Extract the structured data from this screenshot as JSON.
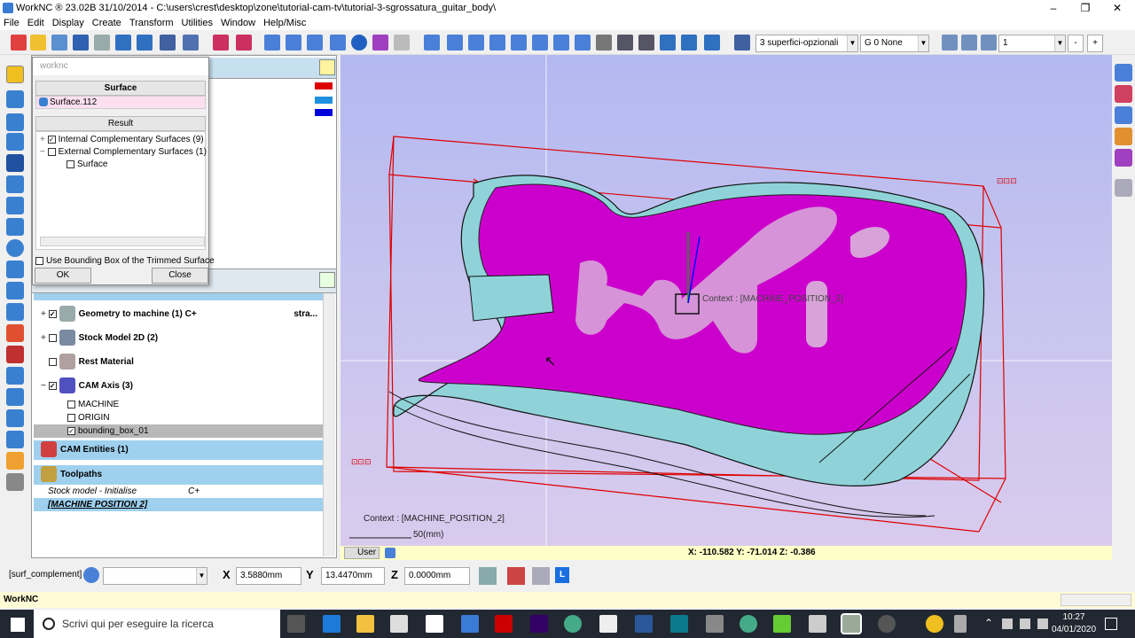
{
  "window": {
    "title": "WorkNC ® 23.02B   31/10/2014 - C:\\users\\crest\\desktop\\zone\\tutorial-cam-tv\\tutorial-3-sgrossatura_guitar_body\\",
    "min": "–",
    "max": "❐",
    "close": "✕"
  },
  "menu": [
    "File",
    "Edit",
    "Display",
    "Create",
    "Transform",
    "Utilities",
    "Window",
    "Help/Misc"
  ],
  "toolbar": {
    "layer_combo": "3   superfici-opzionali",
    "group_combo": "G   0 None",
    "num_combo": "1",
    "minus": "-",
    "plus": "+"
  },
  "dialog": {
    "title": "worknc",
    "surface_header": "Surface",
    "surface_value": "Surface.112",
    "result_header": "Result",
    "result_items": [
      "Internal Complementary Surfaces (9)",
      "External Complementary Surfaces (1)",
      "Surface"
    ],
    "bbox_label": "Use Bounding Box of the Trimmed Surface",
    "ok": "OK",
    "close": "Close"
  },
  "tree": {
    "items": [
      {
        "label": "Geometry to machine (1) C+",
        "extra": "stra..."
      },
      {
        "label": "Stock Model 2D (2)",
        "extra": ""
      },
      {
        "label": "Rest Material",
        "extra": ""
      },
      {
        "label": "CAM Axis (3)",
        "extra": ""
      }
    ],
    "axes": [
      "MACHINE",
      "ORIGIN",
      "bounding_box_01"
    ],
    "cam_entities": "CAM Entities (1)",
    "toolpaths": "Toolpaths",
    "stock_init": "Stock model - Initialise",
    "stock_init_flag": "C+",
    "machine_pos": "[MACHINE POSITION 2]"
  },
  "viewport": {
    "context_label": "Context : [MACHINE_POSITION_2]",
    "context_center": "Context : [MACHINE_POSITION_2]",
    "scale": "50(mm)",
    "user_tab": "User",
    "coords": "X: -110.582   Y: -71.014   Z:   -0.386"
  },
  "command": {
    "name": "[surf_complement]",
    "x_label": "X",
    "x_value": "3.5880mm",
    "y_label": "Y",
    "y_value": "13.4470mm",
    "z_label": "Z",
    "z_value": "0.0000mm",
    "l_btn": "L"
  },
  "app_status": "WorkNC",
  "taskbar": {
    "search": "Scrivi qui per eseguire la ricerca",
    "time": "10:27",
    "date": "04/01/2020"
  },
  "colors": {
    "accent": "#cc00cc",
    "part": "#8fd3d9",
    "bbox": "#dd0000"
  }
}
